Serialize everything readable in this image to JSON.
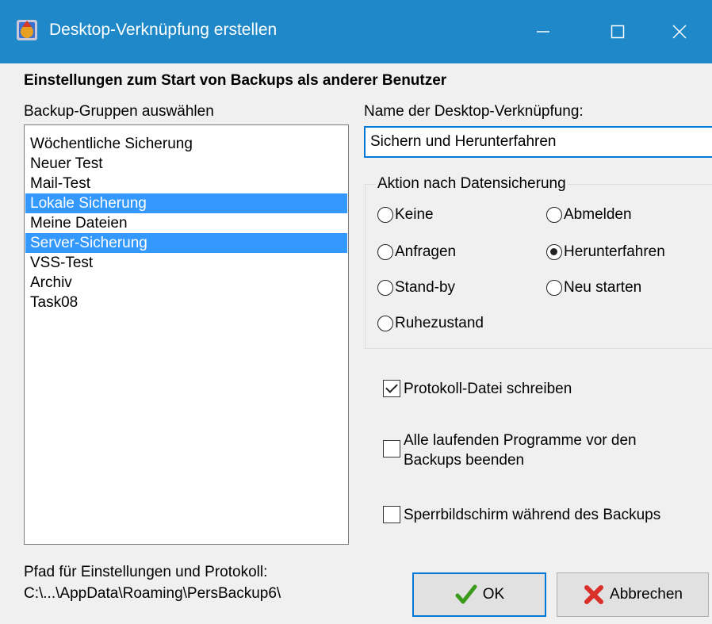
{
  "window": {
    "title": "Desktop-Verknüpfung erstellen",
    "accent_color": "#1e88c8",
    "controls": {
      "minimize": "—",
      "maximize": "☐",
      "close": "✕"
    }
  },
  "heading": "Einstellungen zum Start von Backups als anderer Benutzer",
  "groups": {
    "label": "Backup-Gruppen auswählen",
    "items": [
      {
        "label": "Wöchentliche Sicherung",
        "selected": false
      },
      {
        "label": "Neuer Test",
        "selected": false
      },
      {
        "label": "Mail-Test",
        "selected": false
      },
      {
        "label": "Lokale Sicherung",
        "selected": true
      },
      {
        "label": "Meine Dateien",
        "selected": false
      },
      {
        "label": "Server-Sicherung",
        "selected": true
      },
      {
        "label": "VSS-Test",
        "selected": false
      },
      {
        "label": "Archiv",
        "selected": false
      },
      {
        "label": "Task08",
        "selected": false
      }
    ]
  },
  "shortcut": {
    "label": "Name der Desktop-Verknüpfung:",
    "value": "Sichern und Herunterfahren"
  },
  "action": {
    "legend": "Aktion nach Datensicherung",
    "options": [
      {
        "label": "Keine",
        "checked": false
      },
      {
        "label": "Abmelden",
        "checked": false
      },
      {
        "label": "Anfragen",
        "checked": false
      },
      {
        "label": "Herunterfahren",
        "checked": true
      },
      {
        "label": "Stand-by",
        "checked": false
      },
      {
        "label": "Neu starten",
        "checked": false
      },
      {
        "label": "Ruhezustand",
        "checked": false
      }
    ]
  },
  "options": {
    "write_log": {
      "label": "Protokoll-Datei schreiben",
      "checked": true
    },
    "close_programs": {
      "label": "Alle laufenden Programme vor den Backups beenden",
      "checked": false
    },
    "lock_screen": {
      "label": "Sperrbildschirm während des Backups",
      "checked": false
    }
  },
  "path": {
    "label": "Pfad für Einstellungen und Protokoll:",
    "value": "C:\\...\\AppData\\Roaming\\PersBackup6\\"
  },
  "buttons": {
    "ok": {
      "label": "OK",
      "icon": "checkmark-icon",
      "color": "#3a9a1a"
    },
    "cancel": {
      "label": "Abbrechen",
      "icon": "red-x-icon",
      "color": "#d9302a"
    }
  }
}
